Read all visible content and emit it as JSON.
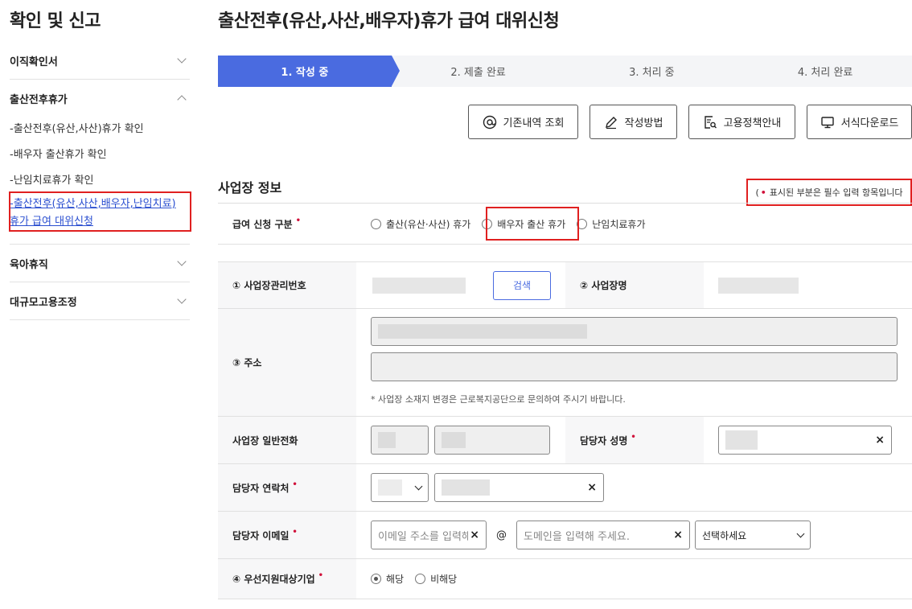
{
  "sidebar": {
    "title": "확인 및 신고",
    "groups": [
      {
        "label": "이직확인서"
      },
      {
        "label": "출산전후휴가",
        "items": [
          "-출산전후(유산,사산)휴가 확인",
          "-배우자 출산휴가 확인",
          "-난임치료휴가 확인"
        ],
        "active_line1": "-출산전후(유산,사산,배우자,난임치료)",
        "active_line2": "휴가 급여 대위신청"
      },
      {
        "label": "육아휴직"
      },
      {
        "label": "대규모고용조정"
      }
    ]
  },
  "main": {
    "title": "출산전후(유산,사산,배우자)휴가 급여 대위신청",
    "steps": [
      "1. 작성 중",
      "2. 제출 완료",
      "3. 처리 중",
      "4. 처리 완료"
    ],
    "tools": {
      "history": "기존내역 조회",
      "howto": "작성방법",
      "policy": "고용정책안내",
      "download": "서식다운로드"
    },
    "section_title": "사업장 정보",
    "required_note_open": "(",
    "required_note_dot": "•",
    "required_note_text": "표시된 부분은 필수 입력 항목입니다",
    "required_dot": "•",
    "form": {
      "benefit_type_label": "급여 신청 구분",
      "benefit_options": [
        "출산(유산·사산) 휴가",
        "배우자 출산 휴가",
        "난임치료휴가"
      ],
      "biz_no_label": "① 사업장관리번호",
      "search_button": "검색",
      "biz_name_label": "② 사업장명",
      "address_label": "③ 주소",
      "address_note": "* 사업장 소재지 변경은 근로복지공단으로 문의하여 주시기 바랍니다.",
      "phone_label": "사업장 일반전화",
      "manager_name_label": "담당자 성명",
      "manager_contact_label": "담당자 연락처",
      "manager_email_label": "담당자 이메일",
      "email_placeholder": "이메일 주소를 입력해",
      "at_sign": "@",
      "domain_placeholder": "도메인을 입력해 주세요.",
      "domain_select": "선택하세요",
      "priority_label": "④ 우선지원대상기업",
      "priority_options": [
        "해당",
        "비해당"
      ],
      "clear": "×"
    }
  }
}
